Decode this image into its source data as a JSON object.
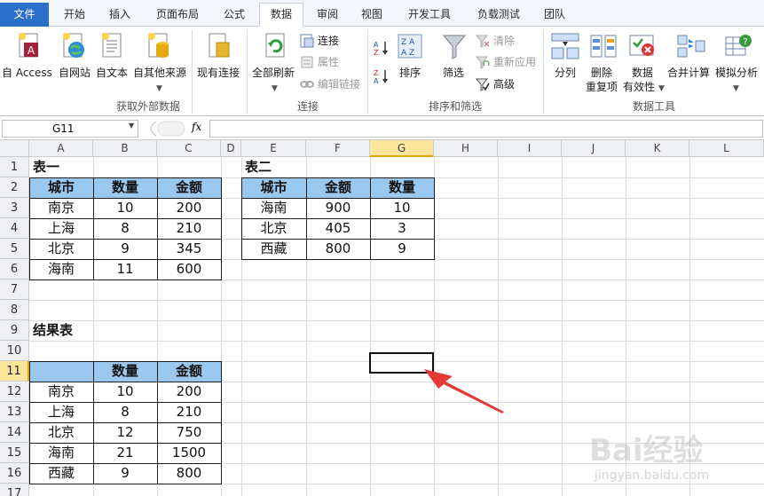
{
  "tabs": [
    "文件",
    "开始",
    "插入",
    "页面布局",
    "公式",
    "数据",
    "审阅",
    "视图",
    "开发工具",
    "负载测试",
    "团队"
  ],
  "ribbon": {
    "access": "自 Access",
    "web": "自网站",
    "text": "自文本",
    "other": "自其他来源",
    "existing": "现有连接",
    "refresh_all": "全部刷新",
    "connections": "连接",
    "properties": "属性",
    "edit_links": "编辑链接",
    "sort": "排序",
    "filter": "筛选",
    "clear": "清除",
    "reapply": "重新应用",
    "advanced": "高级",
    "text_to_columns": "分列",
    "remove_dup_1": "删除",
    "remove_dup_2": "重复项",
    "validation_1": "数据",
    "validation_2": "有效性",
    "consolidate": "合并计算",
    "whatif": "模拟分析",
    "group_external": "获取外部数据",
    "group_connections": "连接",
    "group_sort": "排序和筛选",
    "group_tools": "数据工具"
  },
  "namebox": "G11",
  "fx": "fx",
  "columns": [
    "A",
    "B",
    "C",
    "D",
    "E",
    "F",
    "G",
    "H",
    "I",
    "J",
    "K",
    "L"
  ],
  "rows": [
    "1",
    "2",
    "3",
    "4",
    "5",
    "6",
    "7",
    "8",
    "9",
    "10",
    "11",
    "12",
    "13",
    "14",
    "15",
    "16",
    "17"
  ],
  "sheet": {
    "table1_title": "表一",
    "table1_headers": [
      "城市",
      "数量",
      "金额"
    ],
    "table1_rows": [
      [
        "南京",
        "10",
        "200"
      ],
      [
        "上海",
        "8",
        "210"
      ],
      [
        "北京",
        "9",
        "345"
      ],
      [
        "海南",
        "11",
        "600"
      ]
    ],
    "table2_title": "表二",
    "table2_headers": [
      "城市",
      "金额",
      "数量"
    ],
    "table2_rows": [
      [
        "海南",
        "900",
        "10"
      ],
      [
        "北京",
        "405",
        "3"
      ],
      [
        "西藏",
        "800",
        "9"
      ]
    ],
    "result_title": "结果表",
    "result_headers": [
      "",
      "数量",
      "金额"
    ],
    "result_rows": [
      [
        "南京",
        "10",
        "200"
      ],
      [
        "上海",
        "8",
        "210"
      ],
      [
        "北京",
        "12",
        "750"
      ],
      [
        "海南",
        "21",
        "1500"
      ],
      [
        "西藏",
        "9",
        "800"
      ]
    ]
  },
  "watermark": {
    "brand": "Bai经验",
    "url": "jingyan.baidu.com"
  },
  "colors": {
    "accent": "#2a6fc9",
    "header_fill": "#9bc8ef",
    "select": "#fde69b",
    "arrow": "#e53935"
  }
}
